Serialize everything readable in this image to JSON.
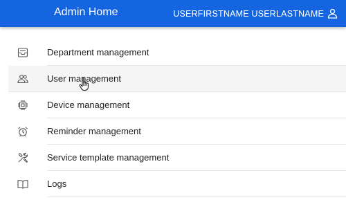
{
  "header": {
    "title": "Admin Home",
    "user_name": "USERFIRSTNAME USERLASTNAME",
    "user_icon": "user-icon",
    "background_color": "#1565e0"
  },
  "menu": {
    "items": [
      {
        "label": "Department management",
        "icon": "inbox-tray-icon"
      },
      {
        "label": "User management",
        "icon": "users-icon"
      },
      {
        "label": "Device management",
        "icon": "chip-icon"
      },
      {
        "label": "Reminder management",
        "icon": "alarm-clock-icon"
      },
      {
        "label": "Service template management",
        "icon": "tools-icon"
      },
      {
        "label": "Logs",
        "icon": "book-icon"
      }
    ]
  }
}
